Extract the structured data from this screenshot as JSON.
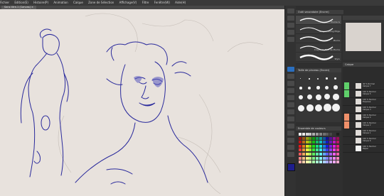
{
  "menubar": {
    "items": [
      "Fichier",
      "Edition(E)",
      "Histoire(P)",
      "Animation",
      "Calque",
      "Zone de Sélection",
      "Affichage(V)",
      "Filtre",
      "Fenêtre(W)",
      "Aide(H)"
    ]
  },
  "document": {
    "tab_label": "Sans titre-1 (Canvas) ×"
  },
  "brush_panel": {
    "title": "Outil secondaire (Encrer)",
    "brushes": [
      "Plume G",
      "Crayon Pilling Edge",
      "Plume",
      "Crayon G Mou de Plume",
      "Stylo",
      "Stylo"
    ]
  },
  "size_panel": {
    "title": "Taille de pinceau (Encrer)",
    "numbers": [
      "0.7",
      "1",
      "1.5",
      "2",
      "2.5",
      "3",
      "4",
      "5",
      "6",
      "7",
      "8",
      "10",
      "12",
      "15",
      "17",
      "20",
      "25",
      "30",
      "40",
      "50"
    ]
  },
  "color_panel": {
    "title": "Ensemble de couleurs"
  },
  "layers_panel": {
    "title": "Calque",
    "layers": [
      {
        "line1": "40 % Normal",
        "line2": "Calque 7"
      },
      {
        "line1": "100 % Normal",
        "line2": "Calque 5"
      },
      {
        "line1": "100 % Normal",
        "line2": "Esquisse"
      },
      {
        "line1": "100 % Normal",
        "line2": "Calque 3"
      },
      {
        "line1": "100 % Normal",
        "line2": "Calque 4"
      },
      {
        "line1": "100 % Normal",
        "line2": "Calque 2"
      },
      {
        "line1": "100 % Normal",
        "line2": "Calque 1"
      },
      {
        "line1": "100 % Normal",
        "line2": "Calque 6"
      },
      {
        "line1": "100 % Normal",
        "line2": "Papier"
      }
    ]
  },
  "colors": {
    "ink": "#2a2a9c",
    "paper": "#e8e2dd",
    "accent": "#2b6fbf"
  }
}
